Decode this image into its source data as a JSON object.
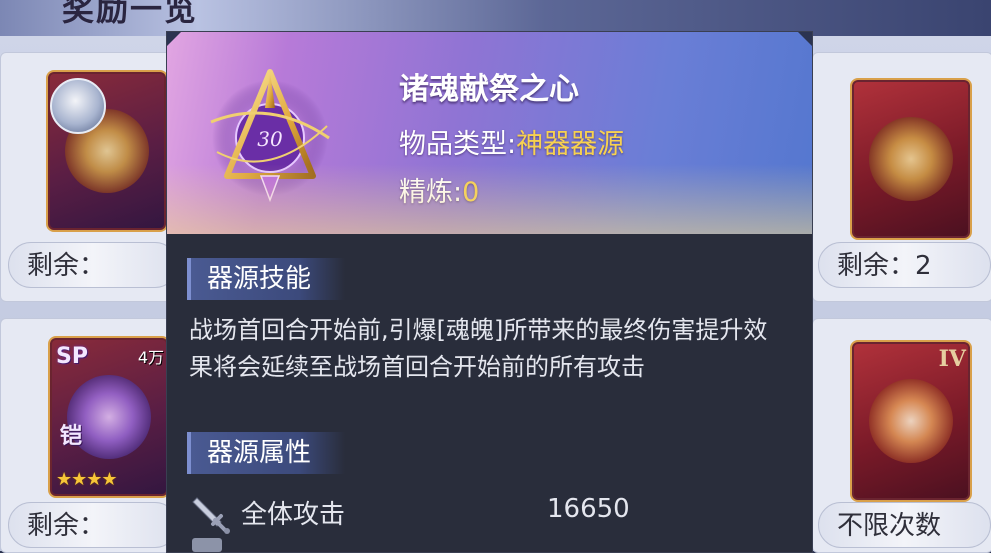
{
  "background": {
    "title": "奖励一览",
    "remain_left_top": "剩余：",
    "remain_left_bottom": "剩余：",
    "remain_right_top": "剩余：2",
    "remain_right_bottom": "不限次数",
    "sp_badge": "SP",
    "sp_side_label": "铠",
    "count_badge": "4万",
    "stars": "★★★★",
    "roman_badge": "IV"
  },
  "tooltip": {
    "item_name": "诸魂献祭之心",
    "type_label": "物品类型:",
    "type_value": "神器器源",
    "refine_label": "精炼:",
    "refine_value": "0",
    "icon_inscription": "30",
    "skill_section": "器源技能",
    "skill_description": "战场首回合开始前,引爆[魂魄]所带来的最终伤害提升效果将会延续至战场首回合开始前的所有攻击",
    "attr_section": "器源属性",
    "attributes": [
      {
        "name": "全体攻击",
        "value": "16650",
        "icon": "sword-icon"
      }
    ]
  },
  "colors": {
    "header_gradient_start": "#e2a6e2",
    "header_gradient_end": "#5477cf",
    "value_yellow": "#f7d150",
    "tooltip_body": "#292d3b"
  }
}
